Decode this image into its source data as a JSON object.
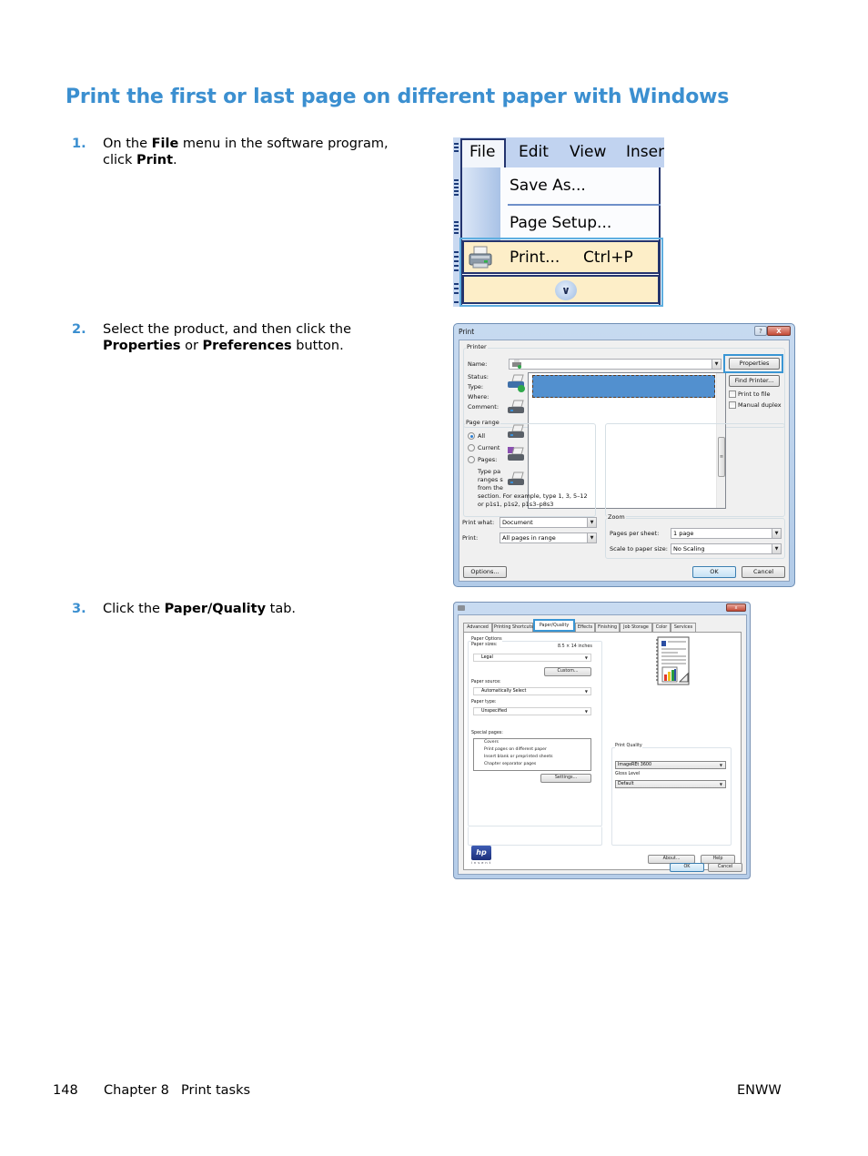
{
  "page": {
    "title": "Print the first or last page on different paper with Windows",
    "accent_color": "#3b8fd0",
    "footer": {
      "page_number": "148",
      "chapter": "Chapter 8",
      "section": "Print tasks",
      "right_label": "ENWW"
    }
  },
  "steps": [
    {
      "number": "1.",
      "text_parts": [
        "On the ",
        "File",
        " menu in the software program, click ",
        "Print",
        "."
      ]
    },
    {
      "number": "2.",
      "text_parts": [
        "Select the product, and then click the ",
        "Properties",
        " or ",
        "Preferences",
        " button."
      ]
    },
    {
      "number": "3.",
      "text_parts": [
        "Click the ",
        "Paper/Quality",
        " tab."
      ]
    }
  ],
  "file_menu": {
    "menubar": [
      {
        "label": "File",
        "underline": "F"
      },
      {
        "label": "Edit",
        "underline": "E"
      },
      {
        "label": "View",
        "underline": "V"
      },
      {
        "label": "Inser",
        "underline": "I"
      }
    ],
    "items": [
      {
        "label": "Save As...",
        "icon": "none"
      },
      {
        "label": "Page Setup...",
        "icon": "none"
      },
      {
        "label": "Print...",
        "shortcut": "Ctrl+P",
        "icon": "printer-icon",
        "highlighted": true
      }
    ],
    "expand_icon": "double-chevron-down-icon",
    "expand_glyph": "»"
  },
  "print_dialog": {
    "title": "Print",
    "help_glyph": "?",
    "close_glyph": "X",
    "printer_group": {
      "title": "Printer",
      "labels": {
        "name": "Name:",
        "status": "Status:",
        "type": "Type:",
        "where": "Where:",
        "comment": "Comment:"
      },
      "properties_button": "Properties",
      "find_printer_button": "Find Printer...",
      "print_to_file": {
        "label": "Print to file",
        "checked": false
      },
      "manual_duplex": {
        "label": "Manual duplex",
        "checked": false
      },
      "printer_list_rows": 6,
      "selected_row": 1
    },
    "page_range": {
      "title": "Page range",
      "options": [
        {
          "label": "All",
          "selected": true
        },
        {
          "label": "Current",
          "selected": false
        },
        {
          "label": "Pages:",
          "selected": false
        }
      ],
      "hint_lines": [
        "Type pa",
        "ranges s",
        "from the",
        "section. For example, type 1, 3, 5–12",
        "or p1s1, p1s2, p1s3–p8s3"
      ]
    },
    "print_what": {
      "label": "Print what:",
      "value": "Document"
    },
    "print": {
      "label": "Print:",
      "value": "All pages in range"
    },
    "zoom": {
      "title": "Zoom",
      "pages_per_sheet": {
        "label": "Pages per sheet:",
        "value": "1 page"
      },
      "scale": {
        "label": "Scale to paper size:",
        "value": "No Scaling"
      }
    },
    "buttons": {
      "options": "Options...",
      "ok": "OK",
      "cancel": "Cancel"
    }
  },
  "properties_dialog": {
    "close_glyph": "x",
    "tabs": [
      {
        "label": "Advanced",
        "active": false
      },
      {
        "label": "Printing Shortcuts",
        "active": false
      },
      {
        "label": "Paper/Quality",
        "active": true
      },
      {
        "label": "Effects",
        "active": false
      },
      {
        "label": "Finishing",
        "active": false
      },
      {
        "label": "Job Storage",
        "active": false
      },
      {
        "label": "Color",
        "active": false
      },
      {
        "label": "Services",
        "active": false
      }
    ],
    "paper_options": {
      "title": "Paper Options",
      "paper_sizes_label": "Paper sizes:",
      "paper_size_dims": "8.5 × 14 inches",
      "paper_size_value": "Legal",
      "custom_button": "Custom...",
      "paper_source_label": "Paper source:",
      "paper_source_value": "Automatically Select",
      "paper_type_label": "Paper type:",
      "paper_type_value": "Unspecified",
      "special_pages_label": "Special pages:",
      "special_pages": [
        "Covers",
        "Print pages on different paper",
        "Insert blank or preprinted sheets",
        "Chapter separator pages"
      ],
      "settings_button": "Settings..."
    },
    "print_quality": {
      "title": "Print Quality",
      "quality_value": "ImageREt 3600",
      "gloss_label": "Gloss Level",
      "gloss_value": "Default"
    },
    "logo": {
      "text": "hp",
      "tagline": "invent"
    },
    "buttons": {
      "about": "About...",
      "help": "Help",
      "ok": "OK",
      "cancel": "Cancel"
    }
  }
}
